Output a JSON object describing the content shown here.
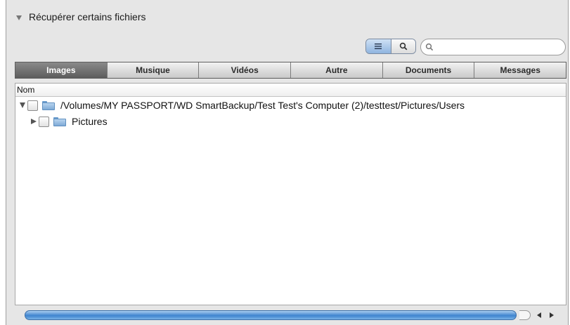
{
  "section": {
    "title": "Récupérer certains fichiers",
    "disclosure_icon": "disclosure-triangle-down"
  },
  "toolbar": {
    "list_view_icon": "list-view-icon",
    "search_view_icon": "magnifier-icon",
    "list_view_active": true
  },
  "search": {
    "value": "",
    "placeholder": "",
    "icon": "magnifier-icon"
  },
  "tabs": [
    {
      "label": "Images",
      "active": true
    },
    {
      "label": "Musique",
      "active": false
    },
    {
      "label": "Vidéos",
      "active": false
    },
    {
      "label": "Autre",
      "active": false
    },
    {
      "label": "Documents",
      "active": false
    },
    {
      "label": "Messages",
      "active": false
    }
  ],
  "list": {
    "column_header": "Nom",
    "rows": [
      {
        "path": "/Volumes/MY PASSPORT/WD SmartBackup/Test Test's Computer (2)/testtest/Pictures/Users",
        "expanded": true,
        "checked": false,
        "level": 0
      },
      {
        "path": "Pictures",
        "expanded": false,
        "checked": false,
        "level": 1
      }
    ]
  },
  "colors": {
    "accent": "#3f84cf",
    "tab_active": "#6e6e6e",
    "folder": "#8fb6de"
  }
}
